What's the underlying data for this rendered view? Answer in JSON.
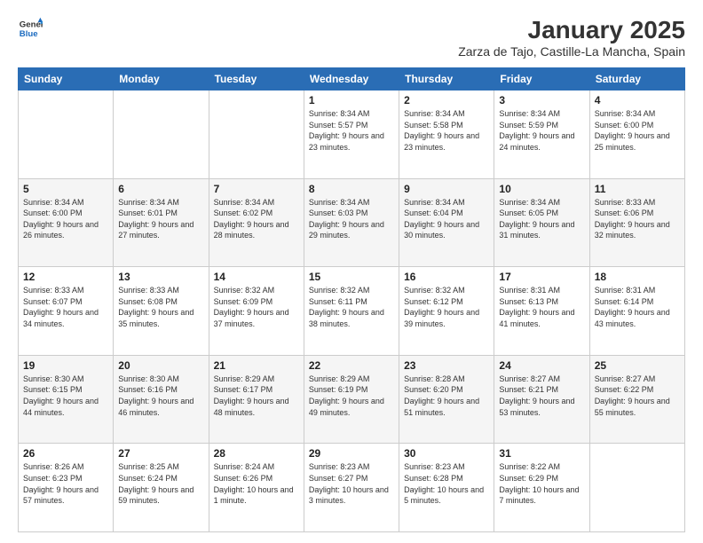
{
  "logo": {
    "line1": "General",
    "line2": "Blue"
  },
  "title": "January 2025",
  "subtitle": "Zarza de Tajo, Castille-La Mancha, Spain",
  "weekdays": [
    "Sunday",
    "Monday",
    "Tuesday",
    "Wednesday",
    "Thursday",
    "Friday",
    "Saturday"
  ],
  "weeks": [
    [
      {
        "day": "",
        "info": ""
      },
      {
        "day": "",
        "info": ""
      },
      {
        "day": "",
        "info": ""
      },
      {
        "day": "1",
        "info": "Sunrise: 8:34 AM\nSunset: 5:57 PM\nDaylight: 9 hours\nand 23 minutes."
      },
      {
        "day": "2",
        "info": "Sunrise: 8:34 AM\nSunset: 5:58 PM\nDaylight: 9 hours\nand 23 minutes."
      },
      {
        "day": "3",
        "info": "Sunrise: 8:34 AM\nSunset: 5:59 PM\nDaylight: 9 hours\nand 24 minutes."
      },
      {
        "day": "4",
        "info": "Sunrise: 8:34 AM\nSunset: 6:00 PM\nDaylight: 9 hours\nand 25 minutes."
      }
    ],
    [
      {
        "day": "5",
        "info": "Sunrise: 8:34 AM\nSunset: 6:00 PM\nDaylight: 9 hours\nand 26 minutes."
      },
      {
        "day": "6",
        "info": "Sunrise: 8:34 AM\nSunset: 6:01 PM\nDaylight: 9 hours\nand 27 minutes."
      },
      {
        "day": "7",
        "info": "Sunrise: 8:34 AM\nSunset: 6:02 PM\nDaylight: 9 hours\nand 28 minutes."
      },
      {
        "day": "8",
        "info": "Sunrise: 8:34 AM\nSunset: 6:03 PM\nDaylight: 9 hours\nand 29 minutes."
      },
      {
        "day": "9",
        "info": "Sunrise: 8:34 AM\nSunset: 6:04 PM\nDaylight: 9 hours\nand 30 minutes."
      },
      {
        "day": "10",
        "info": "Sunrise: 8:34 AM\nSunset: 6:05 PM\nDaylight: 9 hours\nand 31 minutes."
      },
      {
        "day": "11",
        "info": "Sunrise: 8:33 AM\nSunset: 6:06 PM\nDaylight: 9 hours\nand 32 minutes."
      }
    ],
    [
      {
        "day": "12",
        "info": "Sunrise: 8:33 AM\nSunset: 6:07 PM\nDaylight: 9 hours\nand 34 minutes."
      },
      {
        "day": "13",
        "info": "Sunrise: 8:33 AM\nSunset: 6:08 PM\nDaylight: 9 hours\nand 35 minutes."
      },
      {
        "day": "14",
        "info": "Sunrise: 8:32 AM\nSunset: 6:09 PM\nDaylight: 9 hours\nand 37 minutes."
      },
      {
        "day": "15",
        "info": "Sunrise: 8:32 AM\nSunset: 6:11 PM\nDaylight: 9 hours\nand 38 minutes."
      },
      {
        "day": "16",
        "info": "Sunrise: 8:32 AM\nSunset: 6:12 PM\nDaylight: 9 hours\nand 39 minutes."
      },
      {
        "day": "17",
        "info": "Sunrise: 8:31 AM\nSunset: 6:13 PM\nDaylight: 9 hours\nand 41 minutes."
      },
      {
        "day": "18",
        "info": "Sunrise: 8:31 AM\nSunset: 6:14 PM\nDaylight: 9 hours\nand 43 minutes."
      }
    ],
    [
      {
        "day": "19",
        "info": "Sunrise: 8:30 AM\nSunset: 6:15 PM\nDaylight: 9 hours\nand 44 minutes."
      },
      {
        "day": "20",
        "info": "Sunrise: 8:30 AM\nSunset: 6:16 PM\nDaylight: 9 hours\nand 46 minutes."
      },
      {
        "day": "21",
        "info": "Sunrise: 8:29 AM\nSunset: 6:17 PM\nDaylight: 9 hours\nand 48 minutes."
      },
      {
        "day": "22",
        "info": "Sunrise: 8:29 AM\nSunset: 6:19 PM\nDaylight: 9 hours\nand 49 minutes."
      },
      {
        "day": "23",
        "info": "Sunrise: 8:28 AM\nSunset: 6:20 PM\nDaylight: 9 hours\nand 51 minutes."
      },
      {
        "day": "24",
        "info": "Sunrise: 8:27 AM\nSunset: 6:21 PM\nDaylight: 9 hours\nand 53 minutes."
      },
      {
        "day": "25",
        "info": "Sunrise: 8:27 AM\nSunset: 6:22 PM\nDaylight: 9 hours\nand 55 minutes."
      }
    ],
    [
      {
        "day": "26",
        "info": "Sunrise: 8:26 AM\nSunset: 6:23 PM\nDaylight: 9 hours\nand 57 minutes."
      },
      {
        "day": "27",
        "info": "Sunrise: 8:25 AM\nSunset: 6:24 PM\nDaylight: 9 hours\nand 59 minutes."
      },
      {
        "day": "28",
        "info": "Sunrise: 8:24 AM\nSunset: 6:26 PM\nDaylight: 10 hours\nand 1 minute."
      },
      {
        "day": "29",
        "info": "Sunrise: 8:23 AM\nSunset: 6:27 PM\nDaylight: 10 hours\nand 3 minutes."
      },
      {
        "day": "30",
        "info": "Sunrise: 8:23 AM\nSunset: 6:28 PM\nDaylight: 10 hours\nand 5 minutes."
      },
      {
        "day": "31",
        "info": "Sunrise: 8:22 AM\nSunset: 6:29 PM\nDaylight: 10 hours\nand 7 minutes."
      },
      {
        "day": "",
        "info": ""
      }
    ]
  ]
}
